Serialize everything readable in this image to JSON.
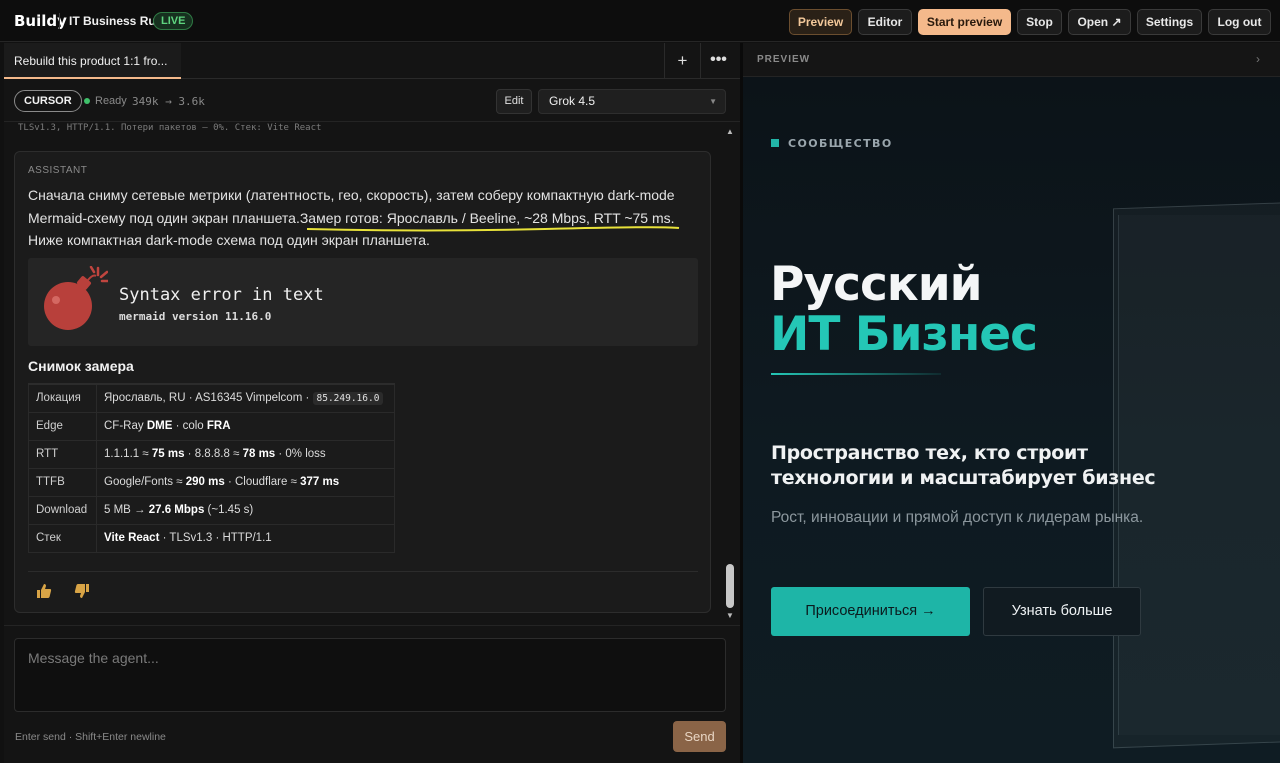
{
  "topbar": {
    "brand": "Buildy",
    "project": "IT Business Ru",
    "live": "LIVE",
    "buttons": {
      "preview": "Preview",
      "editor": "Editor",
      "start_preview": "Start preview",
      "stop": "Stop",
      "open": "Open ↗",
      "settings": "Settings",
      "logout": "Log out"
    }
  },
  "tabs": {
    "active": "Rebuild this product 1:1 fro...",
    "plus": "+",
    "more": "•••"
  },
  "status": {
    "agent": "CURSOR",
    "state": "Ready",
    "tokens": "349k → 3.6k",
    "edit": "Edit",
    "model": "Grok 4.5"
  },
  "chat": {
    "prev_line": "TLSv1.3, HTTP/1.1. Потери пакетов — 0%. Стек: Vite React",
    "role": "ASSISTANT",
    "text_a": "Сначала сниму сетевые метрики (латентность, гео, скорость), затем соберу компактную dark-mode Mermaid-схему под один экран планшета.",
    "text_b": "Замер готов: Ярославль / Beeline, ~28 Mbps, RTT ~75 ms.",
    "text_c": " Ниже компактная dark-mode схема под один экран планшета.",
    "error_title": "Syntax error in text",
    "error_sub": "mermaid version 11.16.0",
    "snapshot_title": "Снимок замера",
    "table": {
      "rows": [
        {
          "key": "Локация",
          "v1": "Ярославль, RU · AS16345 Vimpelcom ·",
          "code": "85.249.16.0"
        },
        {
          "key": "Edge",
          "v1": "CF-Ray ",
          "b1": "DME",
          "v2": " · colo ",
          "b2": "FRA"
        },
        {
          "key": "RTT",
          "v1": "1.1.1.1 ≈ ",
          "b1": "75 ms",
          "v2": " · 8.8.8.8 ≈ ",
          "b2": "78 ms",
          "v3": " · 0% loss"
        },
        {
          "key": "TTFB",
          "v1": "Google/Fonts ≈ ",
          "b1": "290 ms",
          "v2": " · Cloudflare ≈ ",
          "b2": "377 ms"
        },
        {
          "key": "Download",
          "v1": "5 MB → ",
          "b1": "27.6 Mbps",
          "v2": " (~1.45 s)"
        },
        {
          "key": "Стек",
          "b1": "Vite React",
          "v2": " · TLSv1.3 · HTTP/1.1"
        }
      ]
    }
  },
  "composer": {
    "placeholder": "Message the agent...",
    "hint": "Enter send · Shift+Enter newline",
    "send": "Send"
  },
  "preview": {
    "label": "PREVIEW",
    "chevron": "›",
    "community": "СООБЩЕСТВО",
    "title_line1": "Русский",
    "title_line2": "ИТ Бизнес",
    "headline": "Пространство тех, кто строит технологии и масштабирует бизнес",
    "subtitle": "Рост, инновации и прямой доступ к лидерам рынка.",
    "join": "Присоединиться →",
    "learn_more": "Узнать больше"
  },
  "colors": {
    "accent_teal": "#24c7b6",
    "brand_orange": "#f4b98b",
    "live_green": "#5fd47f",
    "error_red": "#c0453f"
  }
}
